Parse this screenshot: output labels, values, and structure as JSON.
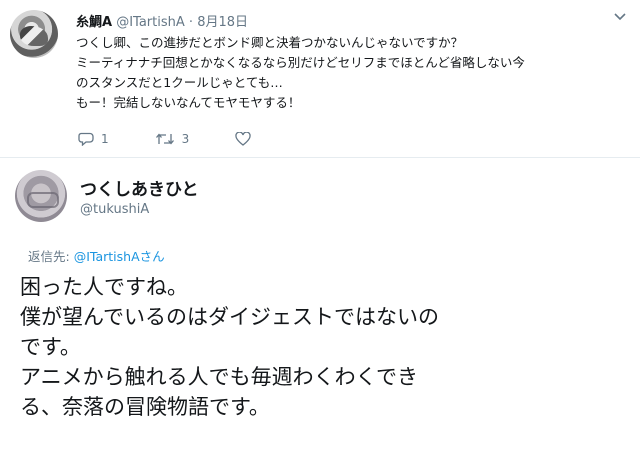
{
  "tweet1": {
    "name": "糸鯛A",
    "handle": "@ITartishA",
    "separator": "·",
    "date": "8月18日",
    "lines": [
      "つくし卿、この進捗だとボンド卿と決着つかないんじゃないですか？",
      "ミーティナナチ回想とかなくなるなら別だけどセリフまでほとんど省略しない今",
      "のスタンスだと1クールじゃとても…",
      "もー！完結しないなんてモヤモヤする！"
    ],
    "reply_count": "1",
    "retweet_count": "3",
    "icons": [
      "reply-icon",
      "retweet-icon",
      "like-icon",
      "more-chevron-icon"
    ]
  },
  "tweet2": {
    "name": "つくしあきひと",
    "handle": "@tukushiA",
    "reply_prefix": "返信先:",
    "reply_to": "@ITartishAさん",
    "lines": [
      "困った人ですね。",
      "僕が望んでいるのはダイジェストではないの",
      "です。",
      "アニメから触れる人でも毎週わくわくでき",
      "る、奈落の冒険物語です。"
    ]
  },
  "colors": {
    "text": "#14171a",
    "secondary": "#657786",
    "link": "#1b95e0",
    "divider": "#e6ecf0"
  }
}
